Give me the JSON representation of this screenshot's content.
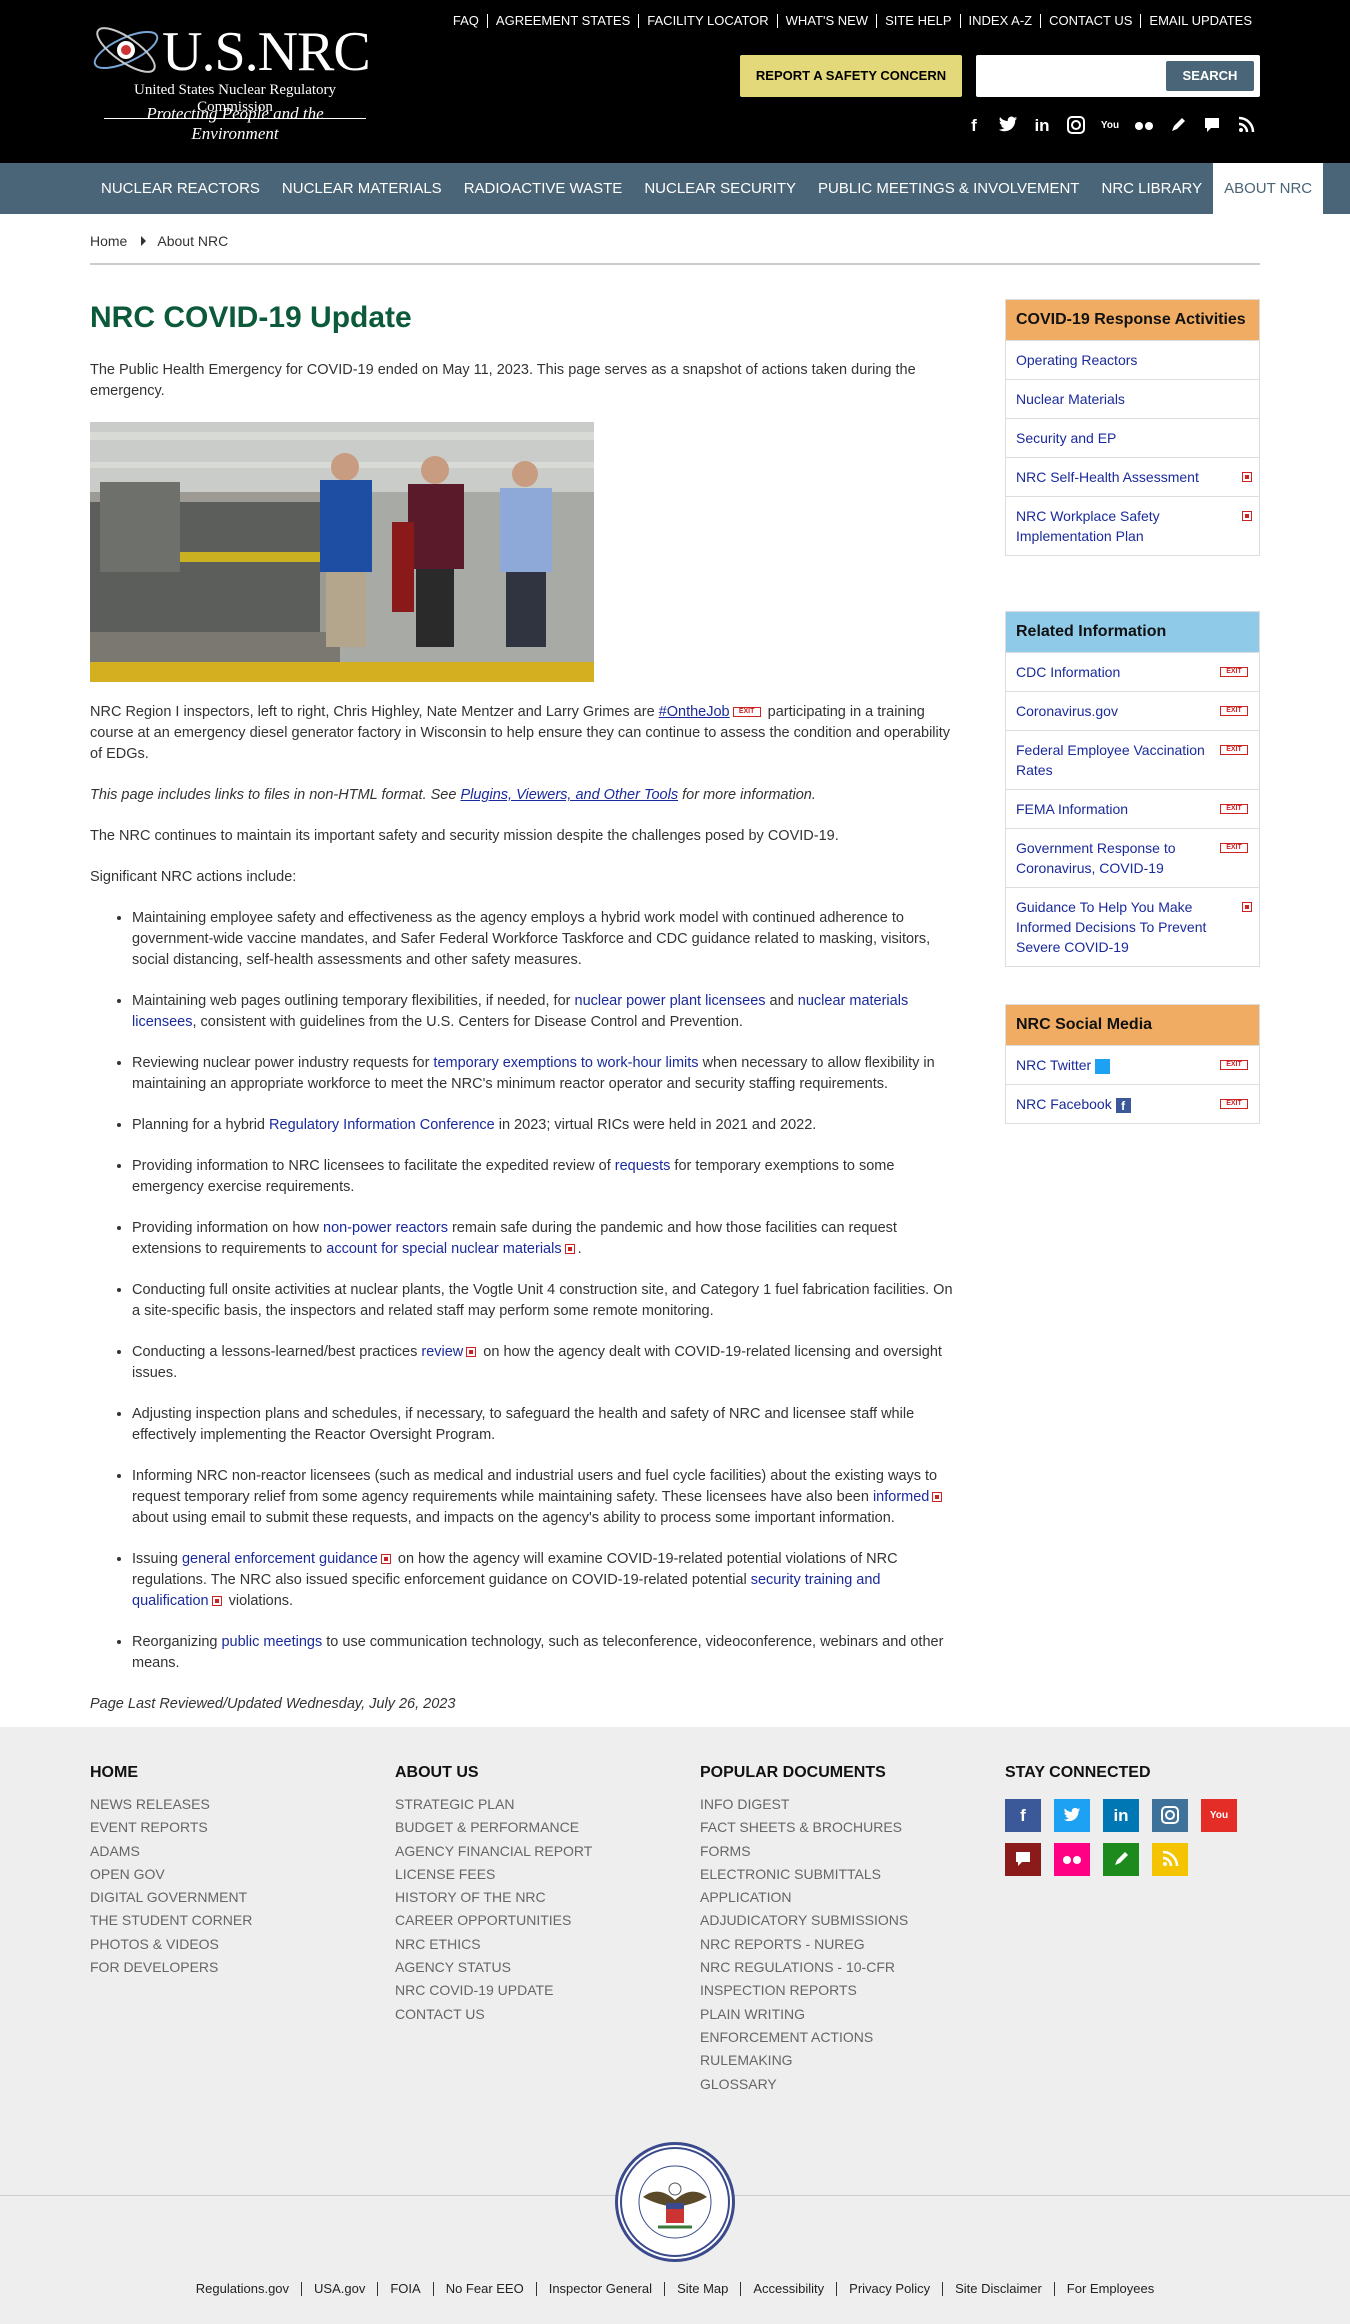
{
  "header": {
    "logo_title": "U.S.NRC",
    "logo_subtitle": "United States Nuclear Regulatory Commission",
    "logo_tagline": "Protecting People and the Environment",
    "top_links": [
      "FAQ",
      "AGREEMENT STATES",
      "FACILITY LOCATOR",
      "WHAT'S NEW",
      "SITE HELP",
      "INDEX A-Z",
      "CONTACT US",
      "EMAIL UPDATES"
    ],
    "report_button": "REPORT A SAFETY CONCERN",
    "search_placeholder": "",
    "search_button": "SEARCH",
    "social_icons": [
      "facebook-icon",
      "twitter-icon",
      "linkedin-icon",
      "instagram-icon",
      "youtube-icon",
      "flickr-icon",
      "blog-icon",
      "comment-icon",
      "rss-icon"
    ]
  },
  "nav": {
    "items": [
      "NUCLEAR REACTORS",
      "NUCLEAR MATERIALS",
      "RADIOACTIVE WASTE",
      "NUCLEAR SECURITY",
      "PUBLIC MEETINGS & INVOLVEMENT",
      "NRC LIBRARY",
      "ABOUT NRC"
    ],
    "active": "ABOUT NRC"
  },
  "breadcrumb": {
    "home": "Home",
    "current": "About NRC"
  },
  "main": {
    "title": "NRC COVID-19 Update",
    "intro": "The Public Health Emergency for COVID-19 ended on May 11, 2023. This page serves as a snapshot of actions taken during the emergency.",
    "caption_a": "NRC Region I inspectors, left to right, Chris Highley, Nate Mentzer and Larry Grimes are ",
    "caption_link": "#OntheJob",
    "caption_b": " participating in a training course at an emergency diesel generator factory in Wisconsin to help ensure they can continue to assess the condition and operability of EDGs.",
    "formats_a": "This page includes links to files in non-HTML format. See ",
    "formats_link": "Plugins, Viewers, and Other Tools",
    "formats_b": " for more information.",
    "mission": "The NRC continues to maintain its important safety and security mission despite the challenges posed by COVID-19.",
    "actions_intro": "Significant NRC actions include:",
    "b1": "Maintaining employee safety and effectiveness as the agency employs a hybrid work model with continued adherence to government-wide vaccine mandates, and Safer Federal Workforce Taskforce and CDC guidance related to masking, visitors, social distancing, self-health assessments and other safety measures.",
    "b2a": "Maintaining web pages outlining temporary flexibilities, if needed, for ",
    "b2l1": "nuclear power plant licensees",
    "b2b": " and ",
    "b2l2": "nuclear materials licensees",
    "b2c": ", consistent with guidelines from the U.S. Centers for Disease Control and Prevention.",
    "b3a": "Reviewing nuclear power industry requests for ",
    "b3l": "temporary exemptions to work-hour limits",
    "b3b": " when necessary to allow flexibility in maintaining an appropriate workforce to meet the NRC's minimum reactor operator and security staffing requirements.",
    "b4a": "Planning for a hybrid ",
    "b4l": "Regulatory Information Conference",
    "b4b": " in 2023; virtual RICs were held in 2021 and 2022.",
    "b5a": "Providing information to NRC licensees to facilitate the expedited review of ",
    "b5l": "requests",
    "b5b": " for temporary exemptions to some emergency exercise requirements.",
    "b6a": "Providing information on how ",
    "b6l1": "non-power reactors",
    "b6b": " remain safe during the pandemic and how those facilities can request extensions to requirements to ",
    "b6l2": "account for special nuclear materials",
    "b6c": ".",
    "b7": "Conducting full onsite activities at nuclear plants, the Vogtle Unit 4 construction site, and Category 1 fuel fabrication facilities. On a site-specific basis, the inspectors and related staff may perform some remote monitoring.",
    "b8a": "Conducting a lessons-learned/best practices ",
    "b8l": "review",
    "b8b": " on how the agency dealt with COVID-19-related licensing and oversight issues.",
    "b9": "Adjusting inspection plans and schedules, if necessary, to safeguard the health and safety of NRC and licensee staff while effectively implementing the Reactor Oversight Program.",
    "b10a": "Informing NRC non-reactor licensees (such as medical and industrial users and fuel cycle facilities) about the existing ways to request temporary relief from some agency requirements while maintaining safety. These licensees have also been ",
    "b10l": "informed",
    "b10b": " about using email to submit these requests, and impacts on the agency's ability to process some important information.",
    "b11a": "Issuing ",
    "b11l1": "general enforcement guidance",
    "b11b": " on how the agency will examine COVID-19-related potential violations of NRC regulations. The NRC also issued specific enforcement guidance on COVID-19-related potential ",
    "b11l2": "security training and qualification",
    "b11c": " violations.",
    "b12a": "Reorganizing ",
    "b12l": "public meetings",
    "b12b": " to use communication technology, such as teleconference, videoconference, webinars and other means.",
    "last_updated": "Page Last Reviewed/Updated Wednesday, July 26, 2023",
    "exit_badge": "EXIT"
  },
  "sidebar": {
    "covid": {
      "title": "COVID-19 Response Activities",
      "items": [
        "Operating Reactors",
        "Nuclear Materials",
        "Security and EP",
        "NRC Self-Health Assessment",
        "NRC Workplace Safety Implementation Plan"
      ]
    },
    "related": {
      "title": "Related Information",
      "items": [
        "CDC Information",
        "Coronavirus.gov",
        "Federal Employee Vaccination Rates",
        "FEMA Information",
        "Government Response to Coronavirus, COVID-19",
        "Guidance To Help You Make Informed Decisions To Prevent Severe COVID-19"
      ]
    },
    "social": {
      "title": "NRC Social Media",
      "items": [
        "NRC Twitter",
        "NRC Facebook"
      ]
    }
  },
  "footer": {
    "home": {
      "title": "HOME",
      "items": [
        "NEWS RELEASES",
        "EVENT REPORTS",
        "ADAMS",
        "OPEN GOV",
        "DIGITAL GOVERNMENT",
        "THE STUDENT CORNER",
        "PHOTOS & VIDEOS",
        "FOR DEVELOPERS"
      ]
    },
    "about": {
      "title": "ABOUT US",
      "items": [
        "STRATEGIC PLAN",
        "BUDGET & PERFORMANCE",
        "AGENCY FINANCIAL REPORT",
        "LICENSE FEES",
        "HISTORY OF THE NRC",
        "CAREER OPPORTUNITIES",
        "NRC ETHICS",
        "AGENCY STATUS",
        "NRC COVID-19 UPDATE",
        "CONTACT US"
      ]
    },
    "popular": {
      "title": "POPULAR DOCUMENTS",
      "items": [
        "INFO DIGEST",
        "FACT SHEETS & BROCHURES",
        "FORMS",
        "ELECTRONIC SUBMITTALS",
        "APPLICATION",
        "ADJUDICATORY SUBMISSIONS",
        "NRC REPORTS - NUREG",
        "NRC REGULATIONS - 10-CFR",
        "INSPECTION REPORTS",
        "PLAIN WRITING",
        "ENFORCEMENT ACTIONS",
        "RULEMAKING",
        "GLOSSARY"
      ]
    },
    "stay": {
      "title": "STAY CONNECTED"
    },
    "seal_text": "UNITED STATES NUCLEAR REGULATORY COMMISSION",
    "bottom_links": [
      "Regulations.gov",
      "USA.gov",
      "FOIA",
      "No Fear EEO",
      "Inspector General",
      "Site Map",
      "Accessibility",
      "Privacy Policy",
      "Site Disclaimer",
      "For Employees"
    ],
    "colors": {
      "facebook": "#3b5998",
      "twitter": "#1da1f2",
      "linkedin": "#0077b5",
      "instagram": "#3f729b",
      "youtube": "#e52d27",
      "comment": "#8b1a1a",
      "flickr": "#ff0084",
      "blog": "#1c8a1c",
      "rss": "#f5c400"
    }
  }
}
